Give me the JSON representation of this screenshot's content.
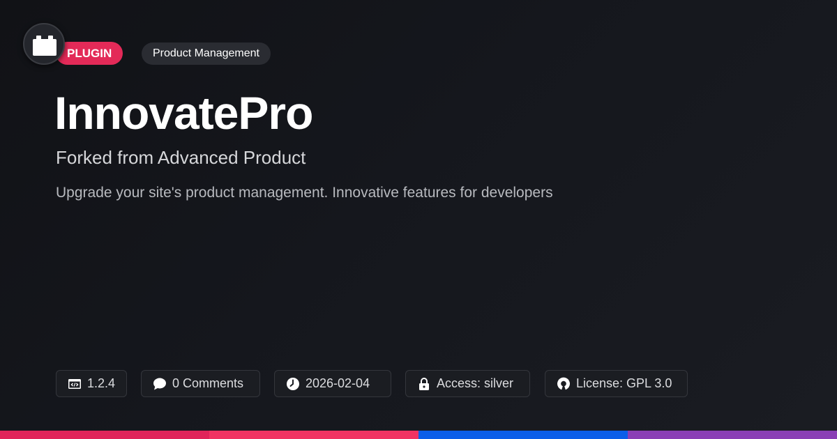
{
  "badges": {
    "type_label": "PLUGIN",
    "category_label": "Product Management"
  },
  "title": "InnovatePro",
  "subtitle": "Forked from Advanced Product",
  "description": "Upgrade your site's product management. Innovative features for developers",
  "meta": {
    "version": "1.2.4",
    "comments": "0 Comments",
    "date": "2026-02-04",
    "access": "Access: silver",
    "license": "License: GPL 3.0"
  },
  "icons": {
    "logo": "plugin-block-icon",
    "version": "code-window-icon",
    "comments": "speech-bubble-icon",
    "date": "clock-icon",
    "access": "lock-icon",
    "license": "open-source-icon"
  },
  "colors": {
    "plugin_badge": "#e32a58",
    "background": "#15171d",
    "bar_segments": [
      "#e0245a",
      "#f03362",
      "#0b5ee8",
      "#8a3fb5"
    ]
  }
}
